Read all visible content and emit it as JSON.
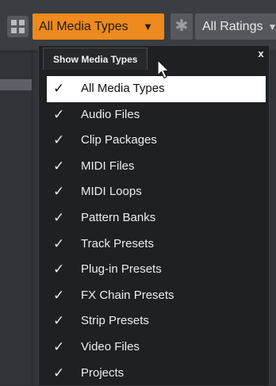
{
  "toolbar": {
    "media_type_value": "All Media Types",
    "rating_value": "All Ratings",
    "accent_color": "#ee8a1e"
  },
  "dropdown": {
    "title": "Show Media Types",
    "close_label": "x",
    "items": [
      {
        "label": "All Media Types",
        "checked": true,
        "active": true
      },
      {
        "label": "Audio Files",
        "checked": true
      },
      {
        "label": "Clip Packages",
        "checked": true
      },
      {
        "label": "MIDI Files",
        "checked": true
      },
      {
        "label": "MIDI Loops",
        "checked": true
      },
      {
        "label": "Pattern Banks",
        "checked": true
      },
      {
        "label": "Track Presets",
        "checked": true
      },
      {
        "label": "Plug-in Presets",
        "checked": true
      },
      {
        "label": "FX Chain Presets",
        "checked": true
      },
      {
        "label": "Strip Presets",
        "checked": true
      },
      {
        "label": "Video Files",
        "checked": true
      },
      {
        "label": "Projects",
        "checked": true
      }
    ]
  },
  "icons": {
    "view_toggle": "grid-layout-icon",
    "rating": "star-icon",
    "check": "checkmark-icon",
    "dropdown_arrow": "triangle-down-icon",
    "cursor": "mouse-pointer-icon"
  }
}
